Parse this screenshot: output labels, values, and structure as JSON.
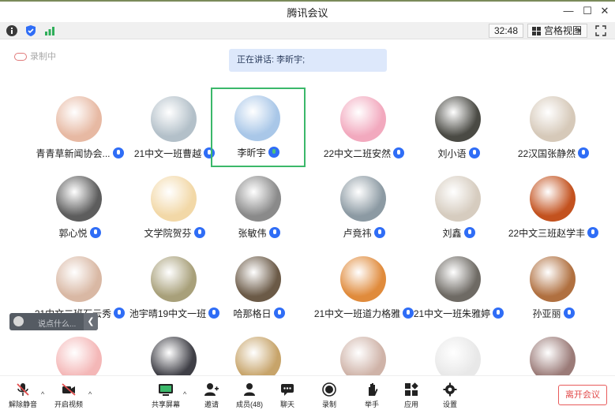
{
  "window": {
    "title": "腾讯会议"
  },
  "toolbar": {
    "timer": "32:48",
    "view_label": "宫格视图"
  },
  "recording_label": "录制中",
  "speaking_label": "正在讲话: 李昕宇;",
  "participants": [
    {
      "name": "青青草新闻协会...",
      "color": "#e7b9a3",
      "active": false
    },
    {
      "name": "21中文一班曹越",
      "color": "#b3c0c9",
      "active": false
    },
    {
      "name": "李昕宇",
      "color": "#a9c7e8",
      "active": true
    },
    {
      "name": "22中文二班安然",
      "color": "#f2a9be",
      "active": false
    },
    {
      "name": "刘小语",
      "color": "#4a4a44",
      "active": false
    },
    {
      "name": "22汉国张静然",
      "color": "#d6c9b9",
      "active": false
    },
    {
      "name": "郭心悦",
      "color": "#5d5d5d",
      "active": false
    },
    {
      "name": "文学院贺芬",
      "color": "#f2d8a7",
      "active": false
    },
    {
      "name": "张敏伟",
      "color": "#8a8a8a",
      "active": false
    },
    {
      "name": "卢竟祎",
      "color": "#8c9aa3",
      "active": false
    },
    {
      "name": "刘鑫",
      "color": "#d6ccbf",
      "active": false
    },
    {
      "name": "22中文三班赵学丰",
      "color": "#c3521f",
      "active": false
    },
    {
      "name": "21中文二班石云秀",
      "color": "#d9b8a4",
      "active": false
    },
    {
      "name": "池宇晴19中文一班",
      "color": "#a8a07a",
      "active": false
    },
    {
      "name": "哈那格日",
      "color": "#6b5a47",
      "active": false
    },
    {
      "name": "21中文一班道力格雅",
      "color": "#e08b3c",
      "active": false
    },
    {
      "name": "21中文一班朱雅婷",
      "color": "#6e6a64",
      "active": false
    },
    {
      "name": "孙亚丽",
      "color": "#b07040",
      "active": false
    },
    {
      "name": "",
      "color": "#f4b7b7",
      "active": false
    },
    {
      "name": "",
      "color": "#3f3f46",
      "active": false
    },
    {
      "name": "",
      "color": "#c7a46a",
      "active": false
    },
    {
      "name": "",
      "color": "#cfb3a8",
      "active": false
    },
    {
      "name": "",
      "color": "#e8e8e8",
      "active": false
    },
    {
      "name": "",
      "color": "#9b7b78",
      "active": false
    }
  ],
  "chat": {
    "placeholder": "说点什么..."
  },
  "bottom": {
    "mute": "解除静音",
    "video": "开启视频",
    "share": "共享屏幕",
    "invite": "邀请",
    "members": "成员(48)",
    "chat": "聊天",
    "record": "录制",
    "hand": "举手",
    "apps": "应用",
    "settings": "设置",
    "leave": "离开会议"
  }
}
